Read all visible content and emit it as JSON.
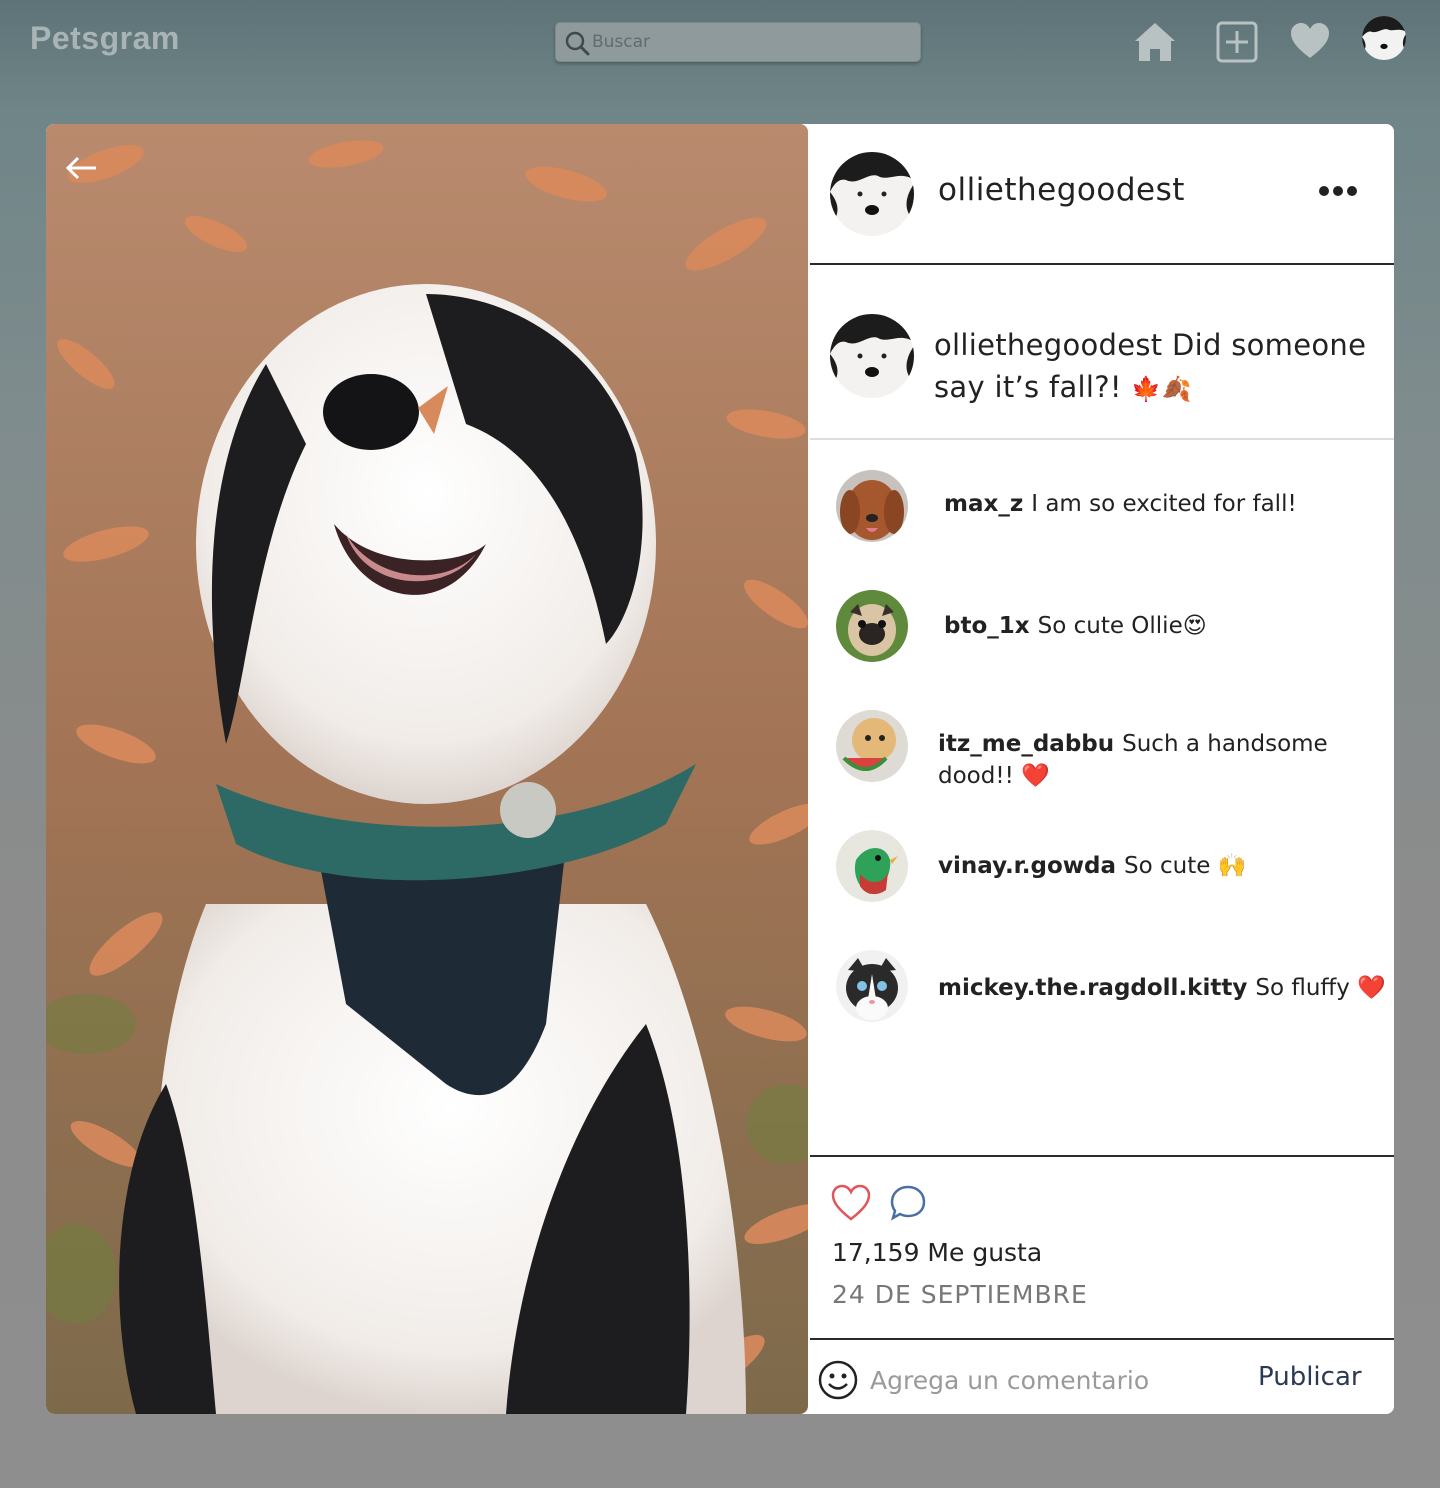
{
  "app": {
    "brand": "Petsgram"
  },
  "search": {
    "placeholder": "Buscar"
  },
  "nav": {
    "icons": [
      "home-icon",
      "add-post-icon",
      "heart-icon",
      "profile-avatar"
    ]
  },
  "post": {
    "username": "olliethegoodest",
    "caption_user": "olliethegoodest",
    "caption_text": "Did someone say it’s fall?!",
    "caption_emoji": "🍁🍂",
    "likes_label": "17,159 Me gusta",
    "date": "24 DE SEPTIEMBRE"
  },
  "comments": [
    {
      "user": "max_z",
      "text": "I am so excited for fall!",
      "emoji": ""
    },
    {
      "user": "bto_1x",
      "text": "So cute Ollie",
      "emoji": "😍"
    },
    {
      "user": "itz_me_dabbu",
      "text": "Such a handsome dood!!",
      "emoji": "❤️"
    },
    {
      "user": "vinay.r.gowda",
      "text": "So cute",
      "emoji": "🙌"
    },
    {
      "user": "mickey.the.ragdoll.kitty",
      "text": "So fluffy",
      "emoji": "❤️"
    }
  ],
  "composer": {
    "placeholder": "Agrega un comentario",
    "publish_label": "Publicar"
  },
  "colors": {
    "like_red": "#e0565b",
    "comment_blue": "#4a6fa5",
    "publish_navy": "#2a3a55"
  }
}
